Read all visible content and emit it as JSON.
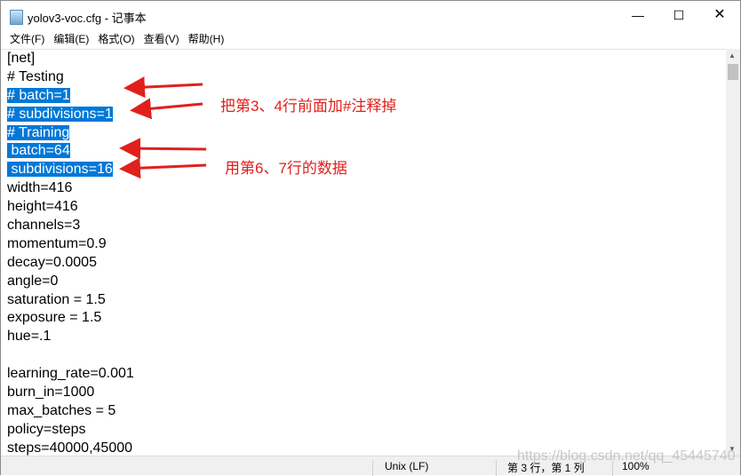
{
  "window": {
    "title": "yolov3-voc.cfg - 记事本",
    "controls": [
      "minimize",
      "maximize",
      "close"
    ]
  },
  "menu": [
    "文件(F)",
    "编辑(E)",
    "格式(O)",
    "查看(V)",
    "帮助(H)"
  ],
  "lines": [
    {
      "text": "[net]",
      "selected": false
    },
    {
      "text": "# Testing",
      "selected": false
    },
    {
      "text": "# batch=1",
      "selected": true
    },
    {
      "text": "# subdivisions=1",
      "selected": true
    },
    {
      "text": "# Training",
      "selected": true
    },
    {
      "text": " batch=64",
      "selected": true
    },
    {
      "text": " subdivisions=16",
      "selected": true
    },
    {
      "text": "width=416",
      "selected": false
    },
    {
      "text": "height=416",
      "selected": false
    },
    {
      "text": "channels=3",
      "selected": false
    },
    {
      "text": "momentum=0.9",
      "selected": false
    },
    {
      "text": "decay=0.0005",
      "selected": false
    },
    {
      "text": "angle=0",
      "selected": false
    },
    {
      "text": "saturation = 1.5",
      "selected": false
    },
    {
      "text": "exposure = 1.5",
      "selected": false
    },
    {
      "text": "hue=.1",
      "selected": false
    },
    {
      "text": "",
      "selected": false
    },
    {
      "text": "learning_rate=0.001",
      "selected": false
    },
    {
      "text": "burn_in=1000",
      "selected": false
    },
    {
      "text": "max_batches = 5",
      "selected": false
    },
    {
      "text": "policy=steps",
      "selected": false
    },
    {
      "text": "steps=40000,45000",
      "selected": false
    }
  ],
  "annotations": [
    "把第3、4行前面加#注释掉",
    "用第6、7行的数据"
  ],
  "annotation_color": "#e0201c",
  "selection_color": "#0078d7",
  "status": {
    "line_ending": "Unix (LF)",
    "position": "第 3 行，第 1 列",
    "zoom": "100%"
  },
  "watermark": "https://blog.csdn.net/qq_45445740"
}
